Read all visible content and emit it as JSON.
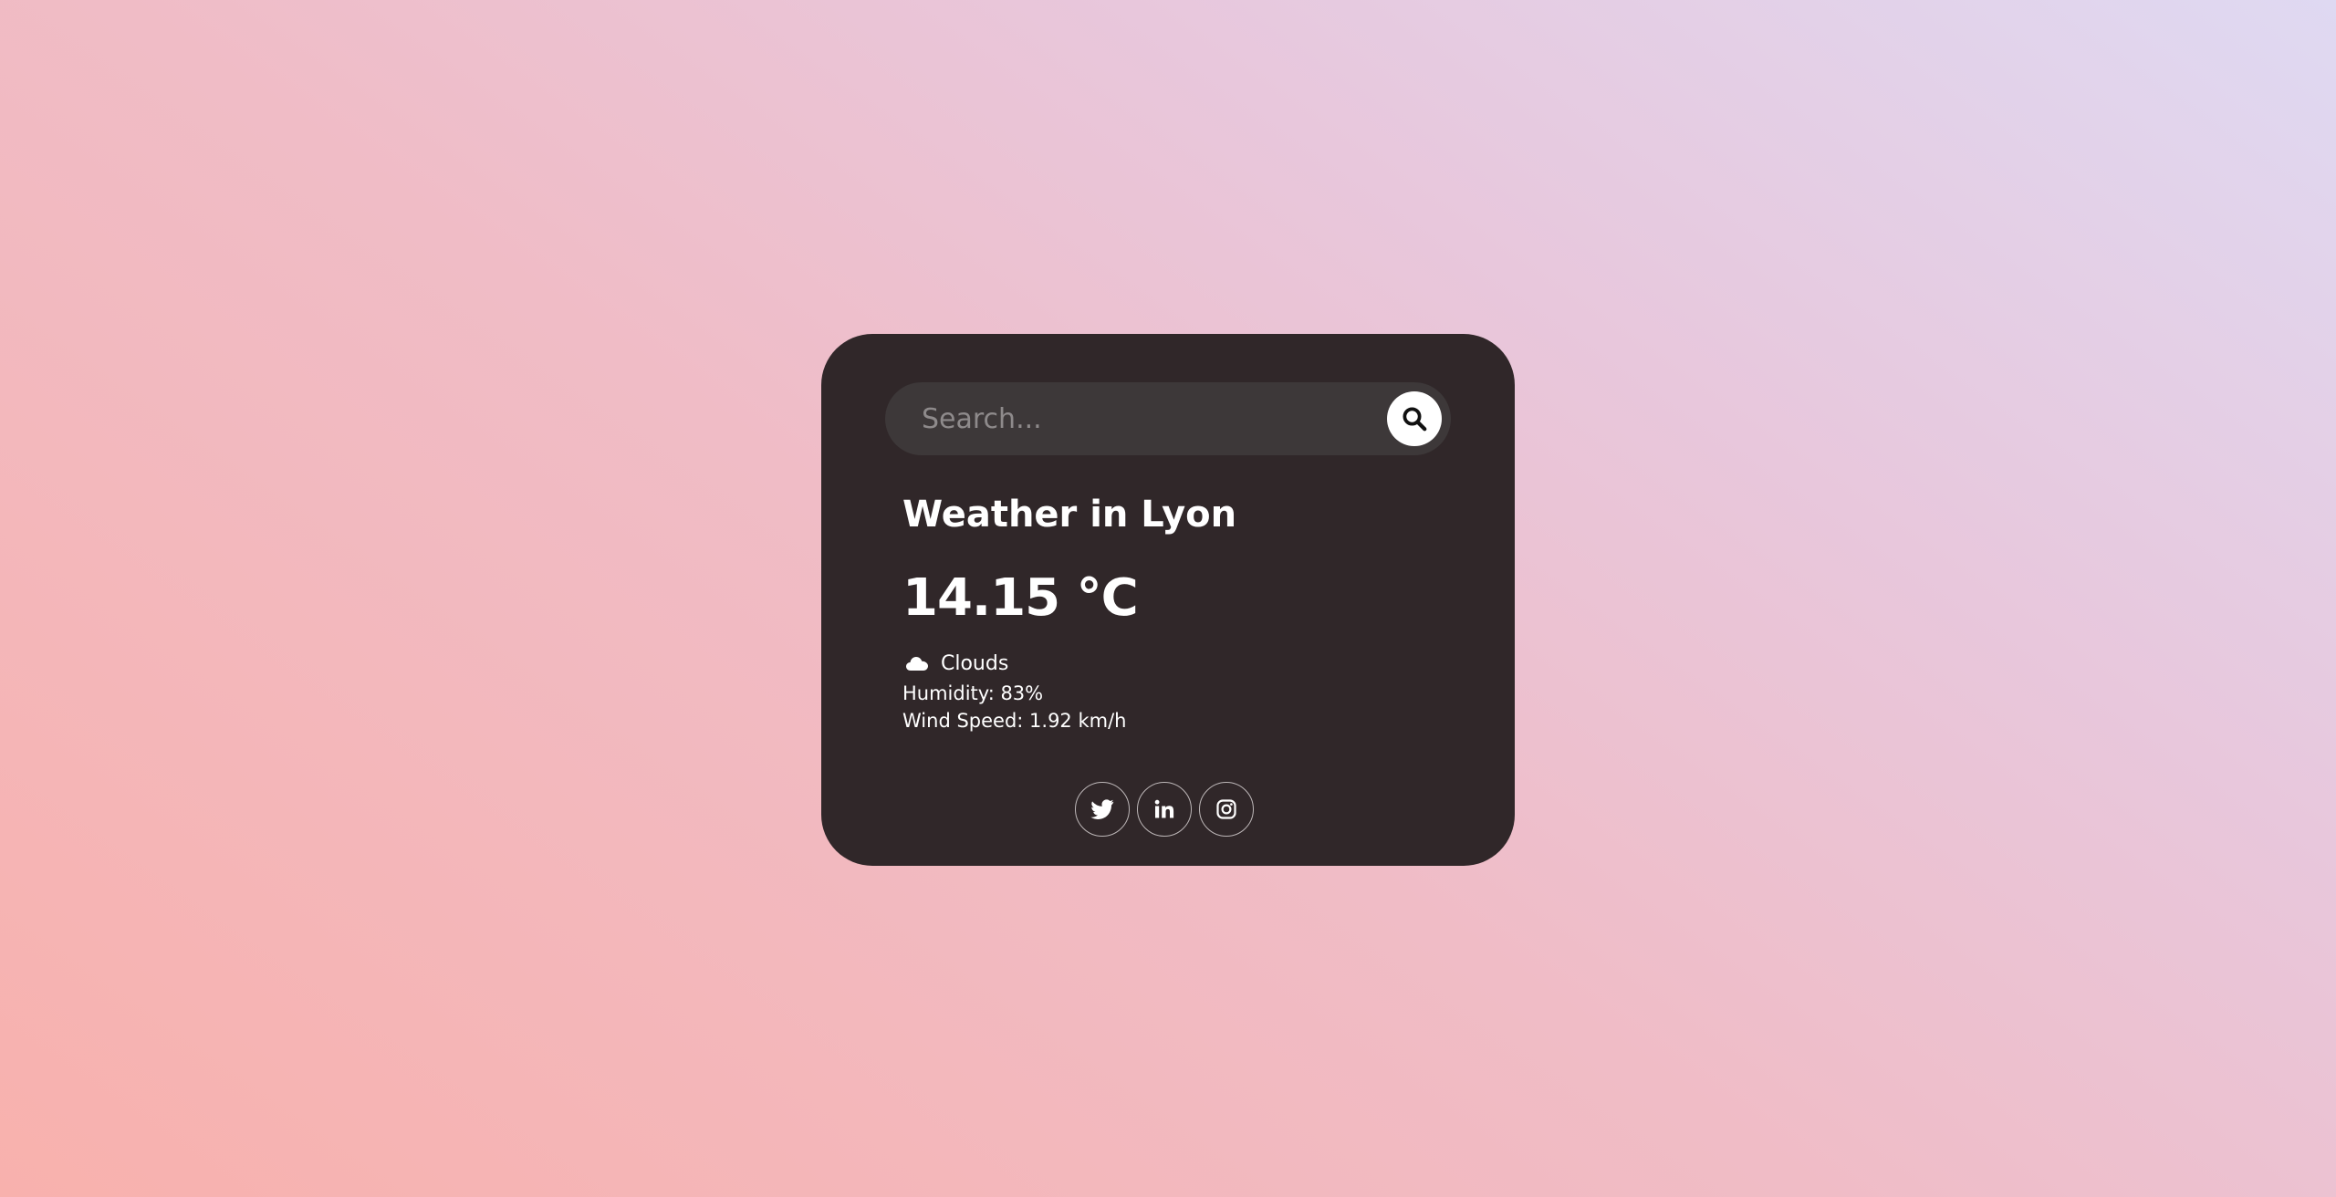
{
  "search": {
    "placeholder": "Search..."
  },
  "weather": {
    "title": "Weather in Lyon",
    "temperature": "14.15 °C",
    "description": "Clouds",
    "description_icon": "cloud-icon",
    "humidity": "Humidity: 83%",
    "wind": "Wind Speed: 1.92 km/h"
  },
  "socials": [
    {
      "icon": "twitter-icon"
    },
    {
      "icon": "linkedin-icon"
    },
    {
      "icon": "instagram-icon"
    }
  ],
  "colors": {
    "card_background": "#302729",
    "search_background": "#3d3839",
    "text": "#ffffff",
    "placeholder": "#8e8a8b",
    "gradient_start": "#f8b1ad",
    "gradient_end": "#dfd9f2"
  }
}
